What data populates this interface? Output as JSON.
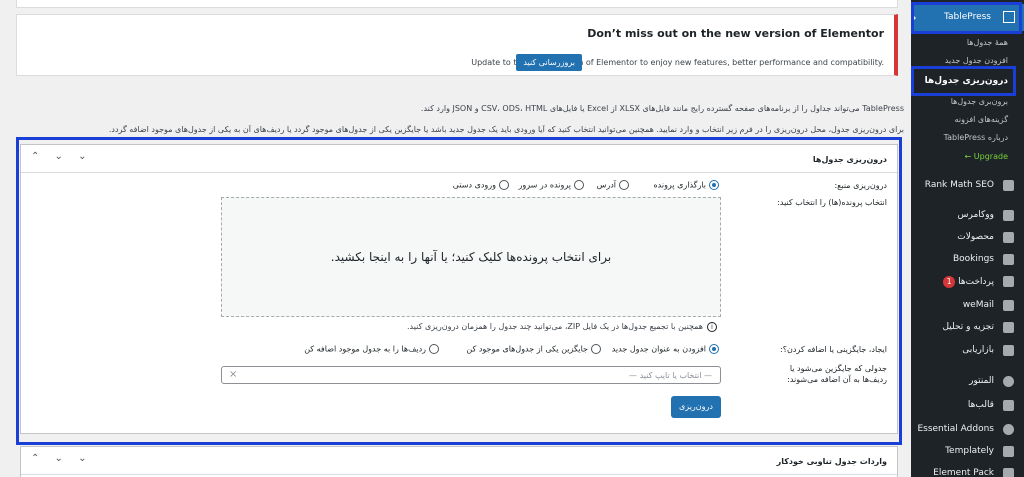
{
  "sidebar": {
    "active_item": "TablePress",
    "submenu": [
      "همهٔ جدول‌ها",
      "افزودن جدول جدید",
      "درون‌ریزی جدول‌ها",
      "برون‌بری جدول‌ها",
      "گزینه‌های افزونه",
      "درباره TablePress",
      "Upgrade ←"
    ],
    "items": [
      {
        "label": "Rank Math SEO",
        "icon": "chart-icon"
      },
      {
        "label": "ووکامرس",
        "icon": "woo-icon"
      },
      {
        "label": "محصولات",
        "icon": "box-icon"
      },
      {
        "label": "Bookings",
        "icon": "calendar-icon"
      },
      {
        "label": "پرداخت‌ها",
        "icon": "dollar-icon",
        "badge": "1"
      },
      {
        "label": "weMail",
        "icon": "mail-icon"
      },
      {
        "label": "تجزیه و تحلیل",
        "icon": "bar-chart-icon"
      },
      {
        "label": "بازاریابی",
        "icon": "megaphone-icon"
      },
      {
        "label": "المنتور",
        "icon": "elementor-icon"
      },
      {
        "label": "قالب‌ها",
        "icon": "folder-icon"
      },
      {
        "label": "Essential Addons",
        "icon": "ea-icon"
      },
      {
        "label": "Templately",
        "icon": "templately-icon"
      },
      {
        "label": "Element Pack",
        "icon": "pack-icon"
      }
    ]
  },
  "notice": {
    "title": "Don’t miss out on the new version of Elementor",
    "message": "Update to the latest version of Elementor to enjoy new features, better performance and compatibility.",
    "button": "بروزرسانی کنید"
  },
  "description": {
    "line1": "TablePress می‌تواند جداول را از برنامه‌های صفحه گسترده رایج مانند فایل‌های XLSX از Excel یا فایل‌های CSV، ODS، HTML و JSON وارد کند.",
    "line2": "برای درون‌ریزی جدول، محل درون‌ریزی را در فرم زیر انتخاب و وارد نمایید. همچنین می‌توانید انتخاب کنید که آیا ورودی باید یک جدول جدید باشد یا جایگزین یکی از جدول‌های موجود گردد یا ردیف‌های آن به یکی از جدول‌های موجود اضافه گردد."
  },
  "import_panel": {
    "title": "درون‌ریزی جدول‌ها",
    "controls": "⌃ ⌄ ⌄",
    "source_label": "درون‌ریزی منبع:",
    "sources": [
      "بارگذاری پرونده",
      "آدرس",
      "پرونده در سرور",
      "ورودی دستی"
    ],
    "select_files_label": "انتخاب پرونده(ها) را انتخاب کنید:",
    "dropzone_text": "برای انتخاب پرونده‌ها کلیک کنید؛ یا آنها را به اینجا بکشید.",
    "zip_note": "همچنین با تجمیع جدول‌ها در یک فایل ZIP، می‌توانید چند جدول را همزمان درون‌ریزی کنید.",
    "mode_label": "ایجاد، جایگزینی یا اضافه کردن؟:",
    "modes": [
      "افزودن به عنوان جدول جدید",
      "جایگزین یکی از جدول‌های موجود کن",
      "ردیف‌ها را به جدول موجود اضافه کن"
    ],
    "target_label": "جدولی که جایگزین می‌شود یا ردیف‌ها به آن اضافه می‌شوند:",
    "target_placeholder": "— انتخاب یا تایپ کنید —",
    "import_button": "درون‌ریزی"
  },
  "auto_panel": {
    "title": "واردات جدول تناوبی خودکار"
  },
  "colors": {
    "accent": "#2271b1",
    "highlight": "#1a3fd6",
    "sidebar_bg": "#1d2327"
  }
}
